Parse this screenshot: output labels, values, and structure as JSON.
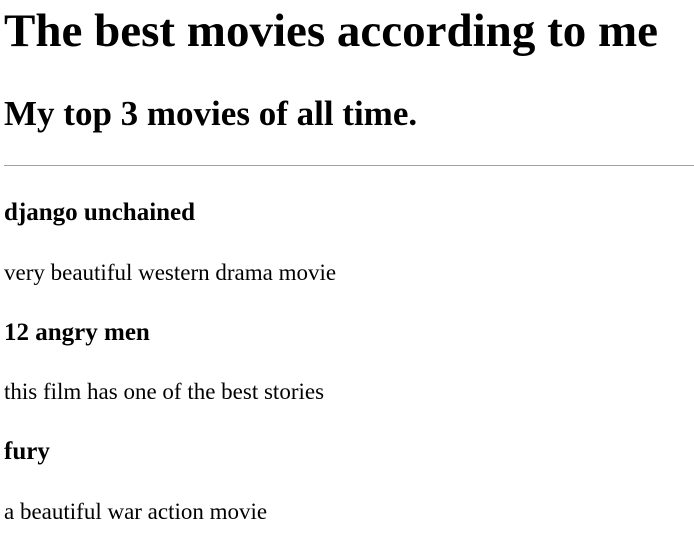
{
  "page": {
    "title": "The best movies according to me",
    "subtitle": "My top 3 movies of all time."
  },
  "movies": [
    {
      "title": "django unchained",
      "description": "very beautiful western drama movie"
    },
    {
      "title": "12 angry men",
      "description": "this film has one of the best stories"
    },
    {
      "title": "fury",
      "description": "a beautiful war action movie"
    }
  ]
}
